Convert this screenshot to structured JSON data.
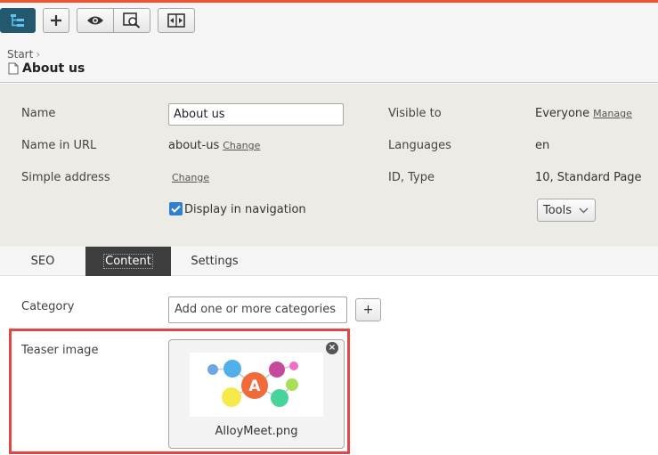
{
  "toolbar": {
    "icons": [
      "page-tree-icon",
      "add-icon",
      "eye-icon",
      "preview-icon",
      "compare-icon"
    ]
  },
  "breadcrumb": {
    "start": "Start",
    "title": "About us"
  },
  "properties": {
    "name_label": "Name",
    "name_value": "About us",
    "url_label": "Name in URL",
    "url_value": "about-us",
    "url_change": "Change",
    "simple_label": "Simple address",
    "simple_change": "Change",
    "visible_label": "Visible to",
    "visible_value": "Everyone",
    "visible_manage": "Manage",
    "languages_label": "Languages",
    "languages_value": "en",
    "id_label": "ID, Type",
    "id_value": "10, Standard Page",
    "display_nav_label": "Display in navigation",
    "display_nav_checked": true,
    "tools_label": "Tools"
  },
  "tabs": [
    {
      "label": "SEO",
      "active": false
    },
    {
      "label": "Content",
      "active": true
    },
    {
      "label": "Settings",
      "active": false
    }
  ],
  "content": {
    "category_label": "Category",
    "category_placeholder": "Add one or more categories",
    "category_add": "+",
    "teaser_label": "Teaser image",
    "teaser_filename": "AlloyMeet.png",
    "teaser_logo_letter": "A"
  },
  "colors": {
    "accent_top": "#f0532b",
    "highlight_frame": "#e24545",
    "active_tab": "#3e3e3e",
    "checkbox": "#2f7fd1"
  }
}
